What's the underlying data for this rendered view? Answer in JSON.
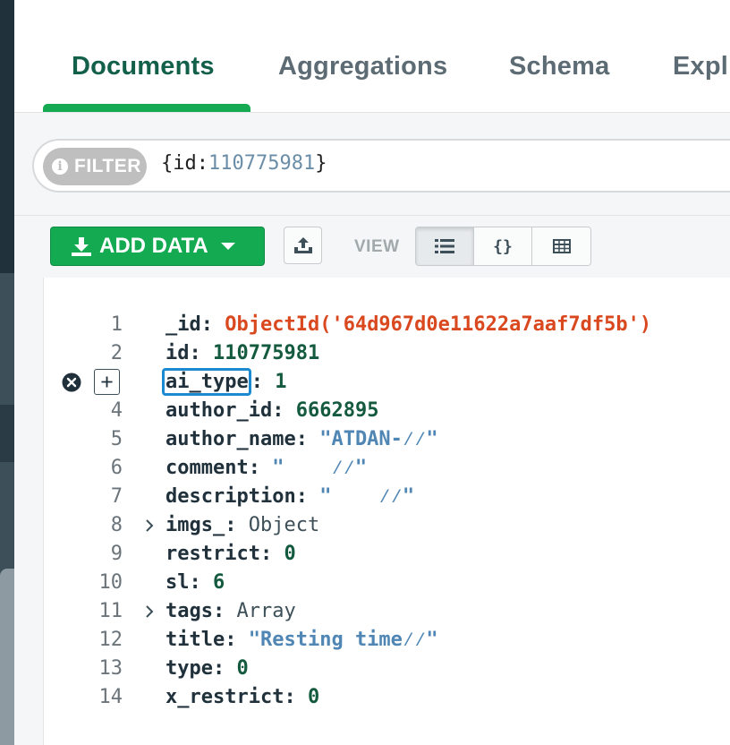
{
  "tabs": [
    {
      "label": "Documents",
      "active": true
    },
    {
      "label": "Aggregations",
      "active": false
    },
    {
      "label": "Schema",
      "active": false
    },
    {
      "label": "Expl",
      "active": false
    }
  ],
  "filter": {
    "pill_label": "FILTER",
    "query_open": "{id:",
    "query_value": "110775981",
    "query_close": "}"
  },
  "toolbar": {
    "add_data_label": "ADD DATA",
    "view_label": "VIEW",
    "view_modes": [
      "list",
      "json",
      "table"
    ],
    "active_view": "list"
  },
  "document": {
    "fields": [
      {
        "line": "1",
        "key": "_id",
        "value": "ObjectId('64d967d0e11622a7aaf7df5b')",
        "type": "oid"
      },
      {
        "line": "2",
        "key": "id",
        "value": "110775981",
        "type": "num"
      },
      {
        "line": "3",
        "key": "ai_type",
        "value": "1",
        "type": "num",
        "editing": true
      },
      {
        "line": "4",
        "key": "author_id",
        "value": "6662895",
        "type": "num"
      },
      {
        "line": "5",
        "key": "author_name",
        "value": "\"ATDAN-⁄⁄\"",
        "type": "str"
      },
      {
        "line": "6",
        "key": "comment",
        "value": "\"    ⁄⁄\"",
        "type": "str"
      },
      {
        "line": "7",
        "key": "description",
        "value": "\"    ⁄⁄\"",
        "type": "str"
      },
      {
        "line": "8",
        "key": "imgs_",
        "value": "Object",
        "type": "type",
        "expandable": true
      },
      {
        "line": "9",
        "key": "restrict",
        "value": "0",
        "type": "num"
      },
      {
        "line": "10",
        "key": "sl",
        "value": "6",
        "type": "num"
      },
      {
        "line": "11",
        "key": "tags",
        "value": "Array",
        "type": "type",
        "expandable": true
      },
      {
        "line": "12",
        "key": "title",
        "value": "\"Resting time⁄⁄\"",
        "type": "str"
      },
      {
        "line": "13",
        "key": "type",
        "value": "0",
        "type": "num"
      },
      {
        "line": "14",
        "key": "x_restrict",
        "value": "0",
        "type": "num"
      }
    ]
  },
  "colors": {
    "accent_green": "#13aa52",
    "active_tab_text": "#13604a",
    "focus_blue": "#1c8ad1",
    "objectid_orange": "#d9481f"
  }
}
